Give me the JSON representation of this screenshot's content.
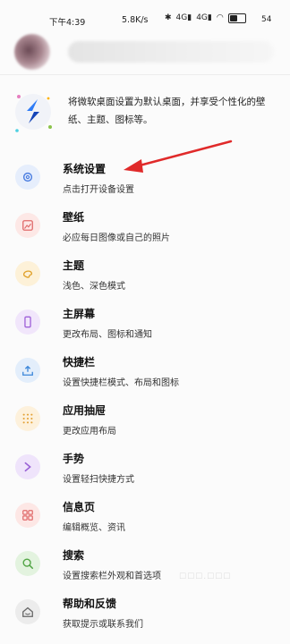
{
  "status_bar": {
    "time": "下午4:39",
    "speed": "5.8K/s",
    "signal1": "4G",
    "signal2": "4G",
    "battery": "54"
  },
  "promo": {
    "text": "将微软桌面设置为默认桌面，并享受个性化的壁纸、主题、图标等。"
  },
  "items": [
    {
      "title": "系统设置",
      "subtitle": "点击打开设备设置",
      "icon": "gear-icon",
      "color": "#4a7de0",
      "bg": "#e6eefc"
    },
    {
      "title": "壁纸",
      "subtitle": "必应每日图像或自己的照片",
      "icon": "image-icon",
      "color": "#e06a6a",
      "bg": "#fde8e6"
    },
    {
      "title": "主题",
      "subtitle": "浅色、深色模式",
      "icon": "palette-icon",
      "color": "#e0a12a",
      "bg": "#fdf1d8"
    },
    {
      "title": "主屏幕",
      "subtitle": "更改布局、图标和通知",
      "icon": "phone-icon",
      "color": "#9f61d8",
      "bg": "#f1e6fb"
    },
    {
      "title": "快捷栏",
      "subtitle": "设置快捷栏模式、布局和图标",
      "icon": "dock-icon",
      "color": "#3b86d9",
      "bg": "#e3eefb"
    },
    {
      "title": "应用抽屉",
      "subtitle": "更改应用布局",
      "icon": "grid-icon",
      "color": "#e3a236",
      "bg": "#fdf1dc"
    },
    {
      "title": "手势",
      "subtitle": "设置轻扫快捷方式",
      "icon": "gesture-icon",
      "color": "#9a62d6",
      "bg": "#efe4fb"
    },
    {
      "title": "信息页",
      "subtitle": "编辑概览、资讯",
      "icon": "feed-icon",
      "color": "#e06a6a",
      "bg": "#fde7e5"
    },
    {
      "title": "搜索",
      "subtitle": "设置搜索栏外观和首选项",
      "icon": "search-icon",
      "color": "#52a545",
      "bg": "#e3f3df"
    },
    {
      "title": "帮助和反馈",
      "subtitle": "获取提示或联系我们",
      "icon": "help-icon",
      "color": "#666666",
      "bg": "#ececec"
    }
  ],
  "colors": {
    "annotation_arrow": "#e02a2a"
  }
}
